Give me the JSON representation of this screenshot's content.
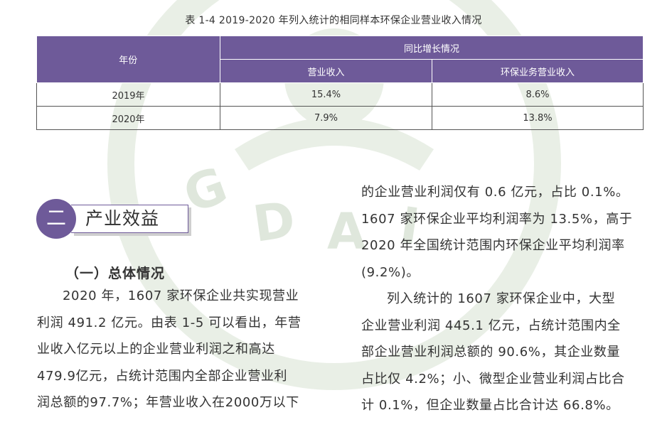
{
  "table": {
    "caption": "表 1-4  2019-2020 年列入统计的相同样本环保企业营业收入情况",
    "header": {
      "year": "年份",
      "group": "同比增长情况",
      "col1": "营业收入",
      "col2": "环保业务营业收入"
    },
    "rows": [
      {
        "year": "2019年",
        "revenue": "15.4%",
        "env_revenue": "8.6%"
      },
      {
        "year": "2020年",
        "revenue": "7.9%",
        "env_revenue": "13.8%"
      }
    ]
  },
  "section": {
    "number": "二",
    "title": "产业效益",
    "subheading": "（一）总体情况"
  },
  "left_paragraph": {
    "lines": [
      "2020 年，1607 家环保企业共实现营业",
      "利润 491.2 亿元。由表 1-5 可以看出，年营",
      "业收入亿元以上的企业营业利润之和高达",
      "479.9亿元，占统计范围内全部企业营业利",
      "润总额的97.7%；年营业收入在2000万以下"
    ]
  },
  "right_paragraph": {
    "lines": [
      "的企业营业利润仅有 0.6 亿元，占比 0.1%。",
      "1607 家环保企业平均利润率为 13.5%，高于",
      "2020 年全国统计范围内环保企业平均利润率",
      "(9.2%)。",
      "列入统计的 1607 家环保企业中，大型",
      "企业营业利润 445.1 亿元，占统计范围内全",
      "部企业营业利润总额的 90.6%，其企业数量",
      "占比仅 4.2%；小、微型企业营业利润占比合",
      "计 0.1%，但企业数量占比合计达 66.8%。"
    ]
  },
  "colors": {
    "accent": "#6e5a99",
    "watermark": "#e9efe6"
  }
}
